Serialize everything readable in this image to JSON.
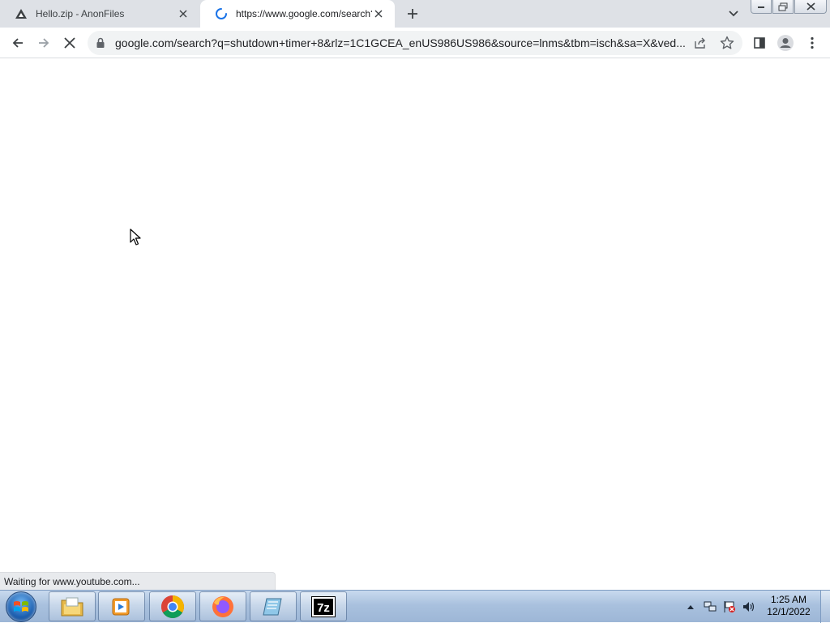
{
  "browser": {
    "tabs": [
      {
        "title": "Hello.zip - AnonFiles",
        "favicon": "anonfiles-icon",
        "active": false
      },
      {
        "title": "https://www.google.com/search?q",
        "favicon": "loading-spinner-icon",
        "active": true
      }
    ],
    "address_bar": {
      "url": "google.com/search?q=shutdown+timer+8&rlz=1C1GCEA_enUS986US986&source=lnms&tbm=isch&sa=X&ved..."
    },
    "status_text": "Waiting for www.youtube.com...",
    "loading": true
  },
  "taskbar": {
    "apps": [
      "file-explorer",
      "media-player",
      "chrome",
      "firefox",
      "notepad",
      "7zip"
    ],
    "seven_zip_label": "7z",
    "clock": {
      "time": "1:25 AM",
      "date": "12/1/2022"
    }
  },
  "colors": {
    "tabstrip_bg": "#dee1e6",
    "omnibox_bg": "#f1f3f4",
    "spinner": "#1a73e8",
    "taskbar": "#a9c1de"
  }
}
